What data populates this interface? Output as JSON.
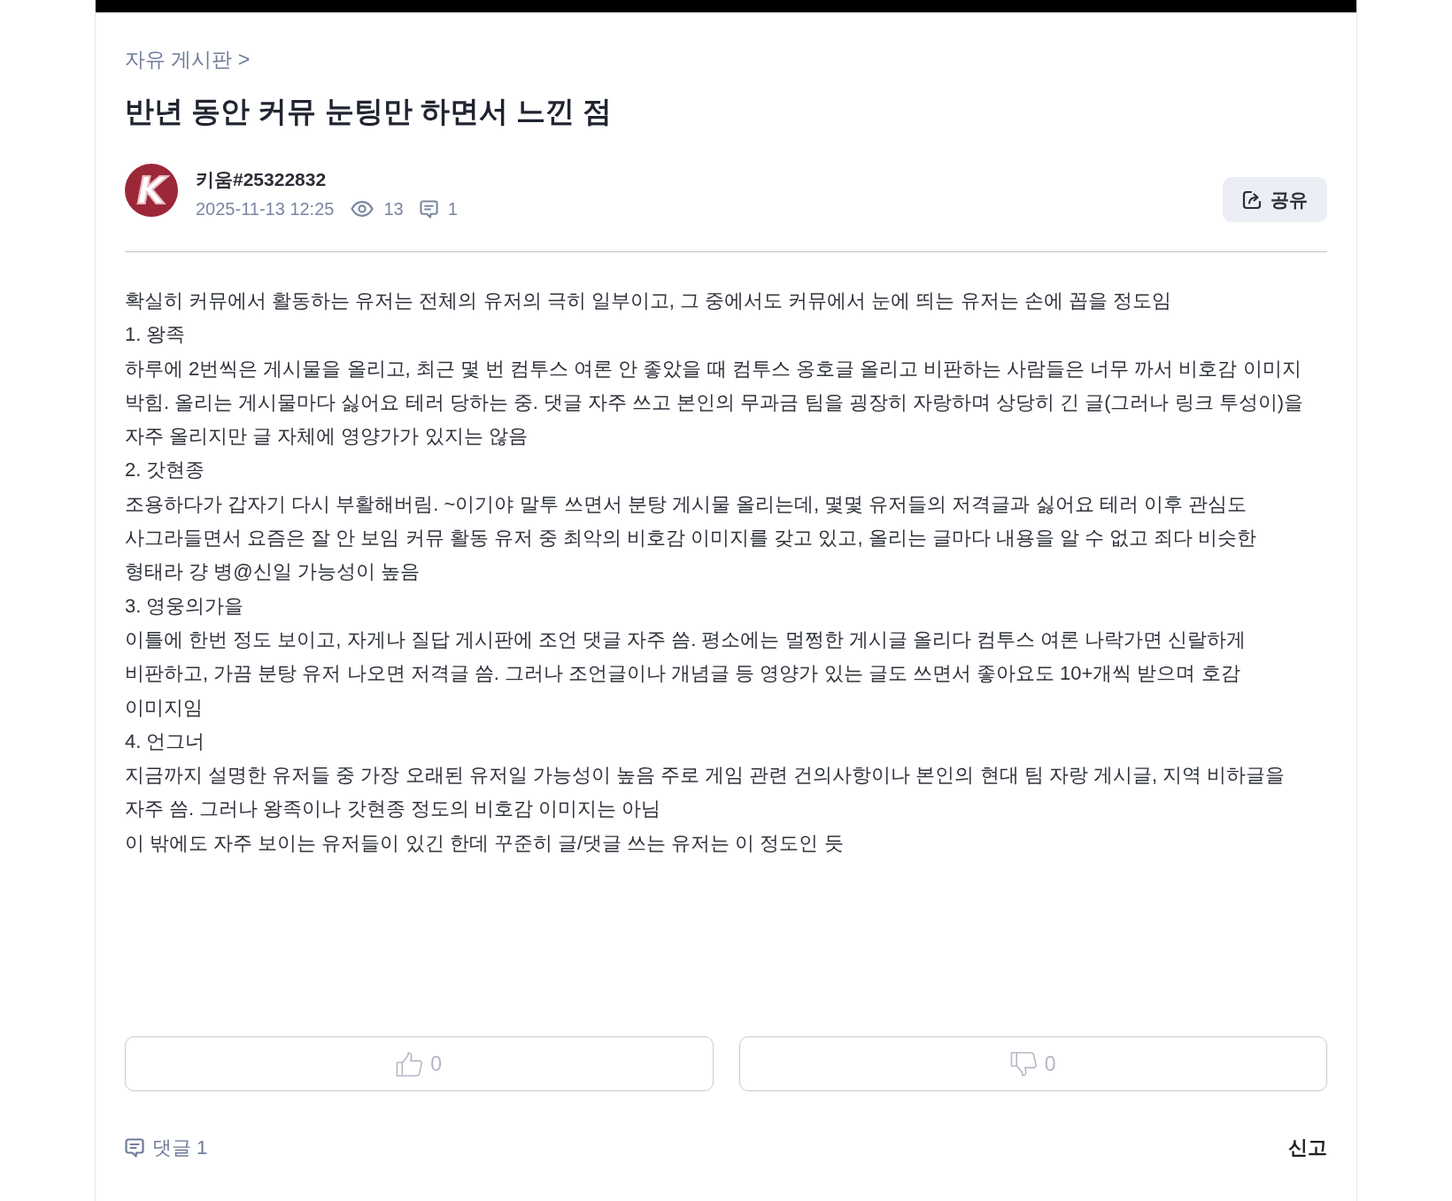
{
  "breadcrumb": "자유 게시판 >",
  "post": {
    "title": "반년 동안 커뮤 눈팅만 하면서 느낀 점",
    "author": {
      "avatar_text": "K",
      "name": "키움#25322832"
    },
    "date": "2025-11-13 12:25",
    "views": "13",
    "comments": "1",
    "share_label": "공유"
  },
  "body": [
    "확실히 커뮤에서 활동하는 유저는 전체의 유저의 극히 일부이고, 그 중에서도 커뮤에서 눈에 띄는 유저는 손에 꼽을 정도임",
    "1. 왕족",
    "하루에 2번씩은 게시물을 올리고, 최근 몇 번 컴투스 여론 안 좋았을 때 컴투스 옹호글 올리고 비판하는 사람들은 너무 까서 비호감 이미지 박힘. 올리는 게시물마다 싫어요 테러 당하는 중. 댓글 자주 쓰고 본인의 무과금 팀을 굉장히 자랑하며 상당히 긴 글(그러나 링크 투성이)을 자주 올리지만 글 자체에 영양가가 있지는 않음",
    "2. 갓현종",
    "조용하다가 갑자기 다시 부활해버림. ~이기야 말투 쓰면서 분탕 게시물 올리는데, 몇몇 유저들의 저격글과 싫어요 테러 이후 관심도 사그라들면서 요즘은 잘 안 보임 커뮤 활동 유저 중 최악의 비호감 이미지를 갖고 있고, 올리는 글마다 내용을 알 수 없고 죄다 비슷한 형태라 걍 병@신일 가능성이 높음",
    "3. 영웅의가을",
    "이틀에 한번 정도 보이고, 자게나 질답 게시판에 조언 댓글 자주 씀. 평소에는 멀쩡한 게시글 올리다 컴투스 여론 나락가면 신랄하게 비판하고, 가끔 분탕 유저 나오면 저격글 씀. 그러나 조언글이나 개념글 등 영양가 있는 글도 쓰면서 좋아요도 10+개씩 받으며 호감 이미지임",
    "4. 언그너",
    "지금까지 설명한 유저들 중 가장 오래된 유저일 가능성이 높음 주로 게임 관련 건의사항이나 본인의 현대 팀 자랑 게시글, 지역 비하글을 자주 씀. 그러나 왕족이나 갓현종 정도의 비호감 이미지는 아님",
    "이 밖에도 자주 보이는 유저들이 있긴 한데 꾸준히 글/댓글 쓰는 유저는 이 정도인 듯"
  ],
  "reactions": [
    {
      "kind": "like",
      "count": "0"
    },
    {
      "kind": "dislike",
      "count": "0"
    }
  ],
  "footer": {
    "comments_label": "댓글 1",
    "report_label": "신고"
  }
}
